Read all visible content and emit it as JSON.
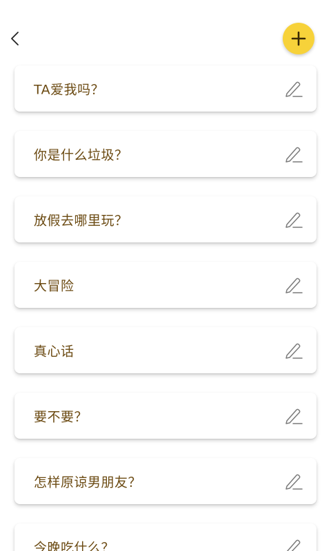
{
  "colors": {
    "accent": "#f7d23a",
    "label_text": "#6b4a12",
    "icon_gray": "#7a7a7a",
    "background": "#ffffff"
  },
  "header": {
    "back_icon": "chevron-left-icon",
    "add_icon": "plus-icon"
  },
  "items": [
    {
      "label": "TA爱我吗？",
      "icon": "pencil-icon"
    },
    {
      "label": "你是什么垃圾？",
      "icon": "pencil-icon"
    },
    {
      "label": "放假去哪里玩？",
      "icon": "pencil-icon"
    },
    {
      "label": "大冒险",
      "icon": "pencil-icon"
    },
    {
      "label": "真心话",
      "icon": "pencil-icon"
    },
    {
      "label": "要不要？",
      "icon": "pencil-icon"
    },
    {
      "label": "怎样原谅男朋友？",
      "icon": "pencil-icon"
    },
    {
      "label": "今晚吃什么？",
      "icon": "pencil-icon"
    }
  ]
}
